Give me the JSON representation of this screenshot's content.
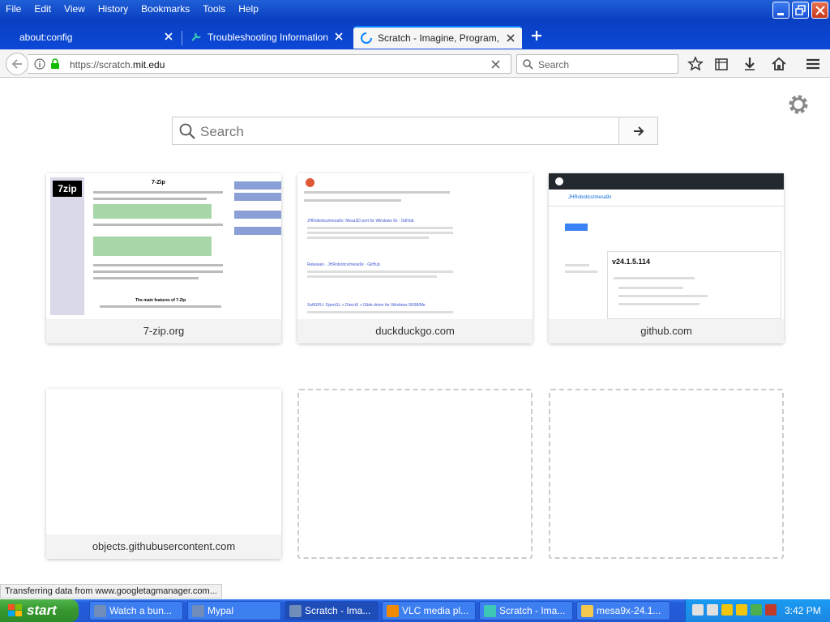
{
  "menu": [
    "File",
    "Edit",
    "View",
    "History",
    "Bookmarks",
    "Tools",
    "Help"
  ],
  "tabs": [
    {
      "label": "about:config"
    },
    {
      "label": "Troubleshooting Information"
    },
    {
      "label": "Scratch - Imagine, Program, Sh"
    }
  ],
  "url": {
    "prefix": "https://scratch.",
    "host": "mit.edu"
  },
  "search": {
    "placeholder": "Search"
  },
  "page": {
    "search_placeholder": "Search",
    "tiles": [
      {
        "label": "7-zip.org"
      },
      {
        "label": "duckduckgo.com"
      },
      {
        "label": "github.com"
      },
      {
        "label": "objects.githubusercontent.com"
      }
    ],
    "thumbs": {
      "sevenzip": {
        "logo": "7zip",
        "title": "7-Zip",
        "features": "The main features of 7-Zip"
      },
      "ddg": {
        "result1": "JHRobotics/mesa9x: Mesa3D port for Windows 9x - GitHub",
        "result2": "Releases · JHRobotics/mesa9x · GitHub",
        "result3": "SoftGPU: OpenGL + DirectX + Glide driver for Windows 95/98/Me"
      },
      "github": {
        "version": "v24.1.5.114",
        "repo": "JHRobotics/mesa9x"
      }
    }
  },
  "status": "Transferring data from www.googletagmanager.com...",
  "taskbar": {
    "start": "start",
    "tasks": [
      {
        "label": "Watch a bun..."
      },
      {
        "label": "Mypal"
      },
      {
        "label": "Scratch - Ima..."
      },
      {
        "label": "VLC media pl..."
      },
      {
        "label": "Scratch - Ima..."
      },
      {
        "label": "mesa9x-24.1..."
      }
    ],
    "clock": "3:42 PM"
  },
  "colors": {
    "accent": "#0a84ff",
    "xp_blue": "#245edb",
    "start_green": "#37962f"
  }
}
